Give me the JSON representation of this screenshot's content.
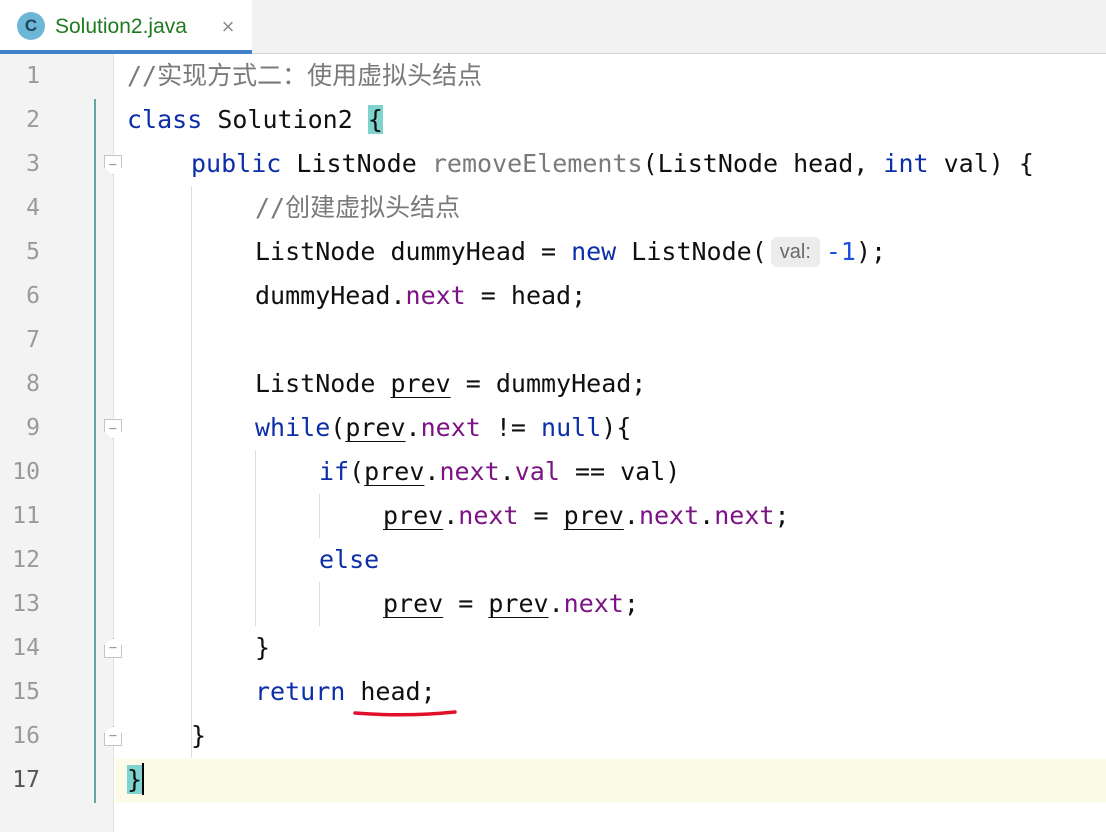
{
  "tab": {
    "icon_letter": "C",
    "file_name": "Solution2.java",
    "close_glyph": "×"
  },
  "line_numbers": [
    "1",
    "2",
    "3",
    "4",
    "5",
    "6",
    "7",
    "8",
    "9",
    "10",
    "11",
    "12",
    "13",
    "14",
    "15",
    "16",
    "17"
  ],
  "code": {
    "l1": {
      "comment": "//实现方式二：使用虚拟头结点"
    },
    "l2": {
      "kw_class": "class",
      "name": "Solution2",
      "brace": "{"
    },
    "l3": {
      "kw_public": "public",
      "type": "ListNode",
      "method": "removeElements",
      "p1": "(ListNode head, ",
      "kw_int": "int",
      "p2": " val) {"
    },
    "l4": {
      "comment": "//创建虚拟头结点"
    },
    "l5": {
      "a": "ListNode dummyHead = ",
      "kw_new": "new",
      "b": " ListNode(",
      "hint": "val:",
      "num": "-1",
      "c": ");"
    },
    "l6": {
      "a": "dummyHead.",
      "field": "next",
      "b": " = head;"
    },
    "l8": {
      "a": "ListNode ",
      "var": "prev",
      "b": " = dummyHead;"
    },
    "l9": {
      "kw_while": "while",
      "a": "(",
      "var": "prev",
      "dot": ".",
      "field": "next",
      "b": " != ",
      "kw_null": "null",
      "c": "){"
    },
    "l10": {
      "kw_if": "if",
      "a": "(",
      "var": "prev",
      "dot1": ".",
      "field1": "next",
      "dot2": ".",
      "field2": "val",
      "b": " == val)"
    },
    "l11": {
      "var1": "prev",
      "dot1": ".",
      "field1": "next",
      "eq": " = ",
      "var2": "prev",
      "dot2": ".",
      "field2": "next",
      "dot3": ".",
      "field3": "next",
      "semi": ";"
    },
    "l12": {
      "kw_else": "else"
    },
    "l13": {
      "var1": "prev",
      "eq": " = ",
      "var2": "prev",
      "dot": ".",
      "field": "next",
      "semi": ";"
    },
    "l14": {
      "brace": "}"
    },
    "l15": {
      "kw_return": "return",
      "sp": " ",
      "word": "head;"
    },
    "l16": {
      "brace": "}"
    },
    "l17": {
      "brace": "}"
    }
  },
  "colors": {
    "keyword": "#0c2ea8",
    "comment": "#7a7a7a",
    "field": "#7b1385",
    "number": "#1f4fe0",
    "brace_match": "#7fd3cf",
    "caret_line": "#fbfbe8",
    "error_underline": "#e0102a",
    "tab_accent": "#4083c9",
    "file_name": "#1f7a1f"
  }
}
